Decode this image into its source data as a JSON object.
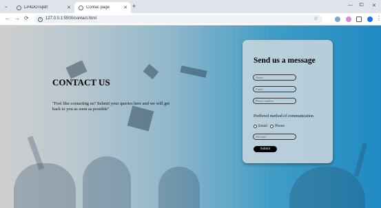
{
  "browser": {
    "tabs": [
      {
        "title": "LP4DOTspdf"
      },
      {
        "title": "Contac page"
      }
    ],
    "new_tab_symbol": "+",
    "window_menu_symbol": "⌄",
    "window_controls": {
      "minimize": "—",
      "maximize": "⧠",
      "close": "✕"
    },
    "nav": {
      "back": "←",
      "forward": "→",
      "reload": "⟳"
    },
    "url": "127.0.0.1:5500/contact.html",
    "bookmark_symbol": "☆"
  },
  "page": {
    "heading": "CONTACT US",
    "intro": "\"Feel like contacting us? Submit your queries here and we will get back to you as soon as possible\"",
    "form": {
      "title": "Send us a message",
      "name_placeholder": "Name",
      "email_placeholder": "Email",
      "phone_placeholder": "Phone number",
      "preference_label": "Preffered method of communication",
      "option_email": "Email",
      "option_phone": "Phone",
      "message_placeholder": "Message",
      "submit_label": "Submit"
    }
  },
  "colors": {
    "gradient_start": "#cfcfcf",
    "gradient_end": "#1f8ac2",
    "submit_bg": "#000000"
  }
}
